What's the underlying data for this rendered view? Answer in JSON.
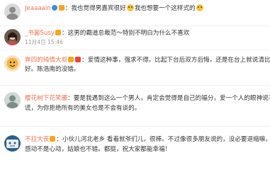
{
  "comments": [
    {
      "username": "Jeaaaain",
      "lines": [
        "：我也觉得男嘉宾很好",
        "我也想要一个这样式的"
      ],
      "timestamp": ""
    },
    {
      "username": "_书菌Susy",
      "lines": [
        "：这男的霸道总裁范～特别不明白为什么不喜欢"
      ],
      "timestamp": "11月4日 15:46"
    },
    {
      "username": "奔四的纯情大叔",
      "lines": [
        "：爱情这种事，强求不得。比起下台后双方后悔，还是在台上就说清比较",
        "好。陈浩南的没错。"
      ],
      "timestamp": ""
    },
    {
      "username": "樱花树下花笑靥",
      "lines": [
        "：要是我遇到这么一个男人，肯定会觉得是自己的福分，爱一个人的眼神说不了",
        "谎，为你拒绝所有的美女也是不会有谈的。"
      ],
      "timestamp": ""
    },
    {
      "username": "不拉大丧",
      "lines": [
        "：小伙儿河北老乡 看着就爷们儿，很棒。不过像很多朋友说的，没必要退缩嘛，毕竟",
        "感动不是心动，姑娘也不错。都挺，祝大家都能幸福！"
      ],
      "timestamp": ""
    }
  ]
}
